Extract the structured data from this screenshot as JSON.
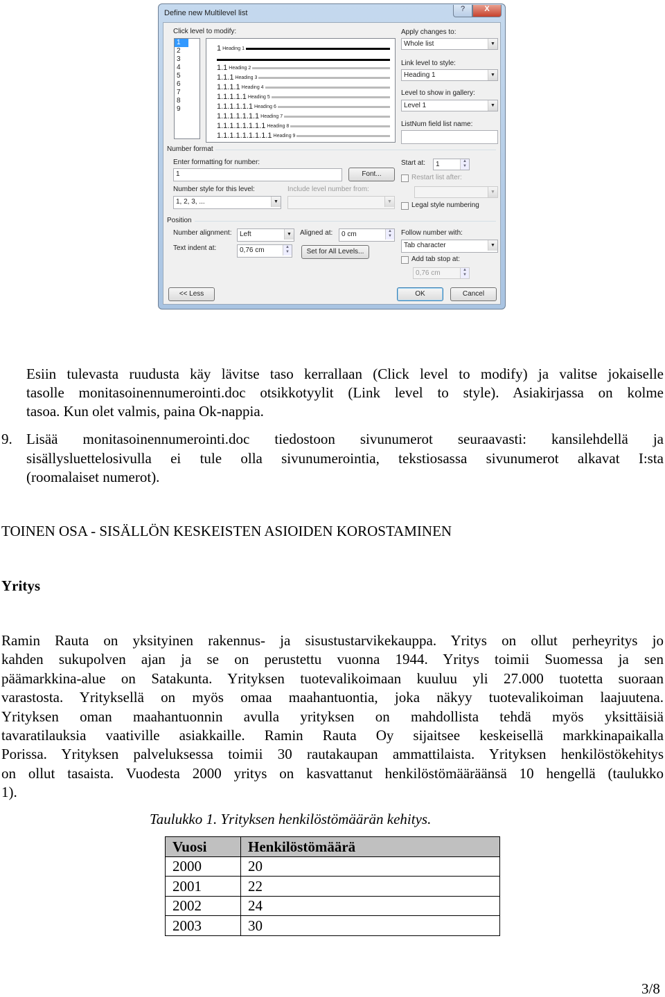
{
  "dialog": {
    "title": "Define new Multilevel list",
    "help_label": "?",
    "close_label": "X",
    "click_level_label": "Click level to modify:",
    "levels": [
      "1",
      "2",
      "3",
      "4",
      "5",
      "6",
      "7",
      "8",
      "9"
    ],
    "preview": [
      {
        "num": "1",
        "heading": "Heading 1"
      },
      {
        "num": "1.1",
        "heading": "Heading 2"
      },
      {
        "num": "1.1.1",
        "heading": "Heading 3"
      },
      {
        "num": "1.1.1.1",
        "heading": "Heading 4"
      },
      {
        "num": "1.1.1.1.1",
        "heading": "Heading 5"
      },
      {
        "num": "1.1.1.1.1.1",
        "heading": "Heading 6"
      },
      {
        "num": "1.1.1.1.1.1.1",
        "heading": "Heading 7"
      },
      {
        "num": "1.1.1.1.1.1.1.1",
        "heading": "Heading 8"
      },
      {
        "num": "1.1.1.1.1.1.1.1.1",
        "heading": "Heading 9"
      }
    ],
    "apply_changes_label": "Apply changes to:",
    "apply_changes_value": "Whole list",
    "link_level_label": "Link level to style:",
    "link_level_value": "Heading 1",
    "gallery_label": "Level to show in gallery:",
    "gallery_value": "Level 1",
    "listnum_label": "ListNum field list name:",
    "listnum_value": "",
    "number_format_label": "Number format",
    "enter_formatting_label": "Enter formatting for number:",
    "enter_formatting_value": "1",
    "font_button": "Font...",
    "start_at_label": "Start at:",
    "start_at_value": "1",
    "restart_label": "Restart list after:",
    "number_style_label": "Number style for this level:",
    "number_style_value": "1, 2, 3, ...",
    "include_level_label": "Include level number from:",
    "legal_label": "Legal style numbering",
    "position_label": "Position",
    "alignment_label": "Number alignment:",
    "alignment_value": "Left",
    "aligned_at_label": "Aligned at:",
    "aligned_at_value": "0 cm",
    "text_indent_label": "Text indent at:",
    "text_indent_value": "0,76 cm",
    "set_all_button": "Set for All Levels...",
    "follow_label": "Follow number with:",
    "follow_value": "Tab character",
    "add_tab_label": "Add tab stop at:",
    "add_tab_value": "0,76 cm",
    "less_button": "<< Less",
    "ok_button": "OK",
    "cancel_button": "Cancel"
  },
  "para1": [
    "Esiin tulevasta ruudusta käy lävitse taso kerrallaan (Click level to modify) ja valitse jokaiselle",
    "tasolle monitasoinennumerointi.doc otsikkotyylit (Link level to style). Asiakirjassa on kolme",
    "tasoa. Kun olet valmis, paina Ok-nappia."
  ],
  "item9_num": "9.",
  "item9": [
    "Lisää monitasoinennumerointi.doc tiedostoon sivunumerot seuraavasti: kansilehdellä ja",
    "sisällysluettelosivulla ei tule olla sivunumerointia, tekstiosassa sivunumerot alkavat I:sta",
    "(roomalaiset numerot)."
  ],
  "section_heading": "TOINEN OSA - SISÄLLÖN KESKEISTEN ASIOIDEN KOROSTAMINEN",
  "subheading": "Yritys",
  "body": [
    "Ramin Rauta on yksityinen rakennus- ja sisustustarvikekauppa. Yritys on ollut perheyritys jo",
    "kahden sukupolven ajan ja se on perustettu vuonna 1944. Yritys toimii Suomessa ja sen",
    "päämarkkina-alue on Satakunta. Yrityksen tuotevalikoimaan kuuluu yli 27.000 tuotetta suoraan",
    "varastosta. Yrityksellä on myös omaa maahantuontia, joka näkyy tuotevalikoiman laajuutena.",
    "Yrityksen oman maahantuonnin avulla yrityksen on mahdollista tehdä myös yksittäisiä",
    "tavaratilauksia vaativille asiakkaille. Ramin Rauta Oy sijaitsee keskeisellä markkinapaikalla",
    "Porissa. Yrityksen palveluksessa toimii 30 rautakaupan ammattilaista. Yrityksen henkilöstökehitys",
    "on ollut tasaista. Vuodesta 2000 yritys on kasvattanut henkilöstömääräänsä 10 hengellä (taulukko",
    "1)."
  ],
  "table_caption": "Taulukko 1. Yrityksen henkilöstömäärän kehitys.",
  "table": {
    "headers": [
      "Vuosi",
      "Henkilöstömäärä"
    ],
    "rows": [
      [
        "2000",
        "20"
      ],
      [
        "2001",
        "22"
      ],
      [
        "2002",
        "24"
      ],
      [
        "2003",
        "30"
      ]
    ]
  },
  "page_number": "3/8"
}
